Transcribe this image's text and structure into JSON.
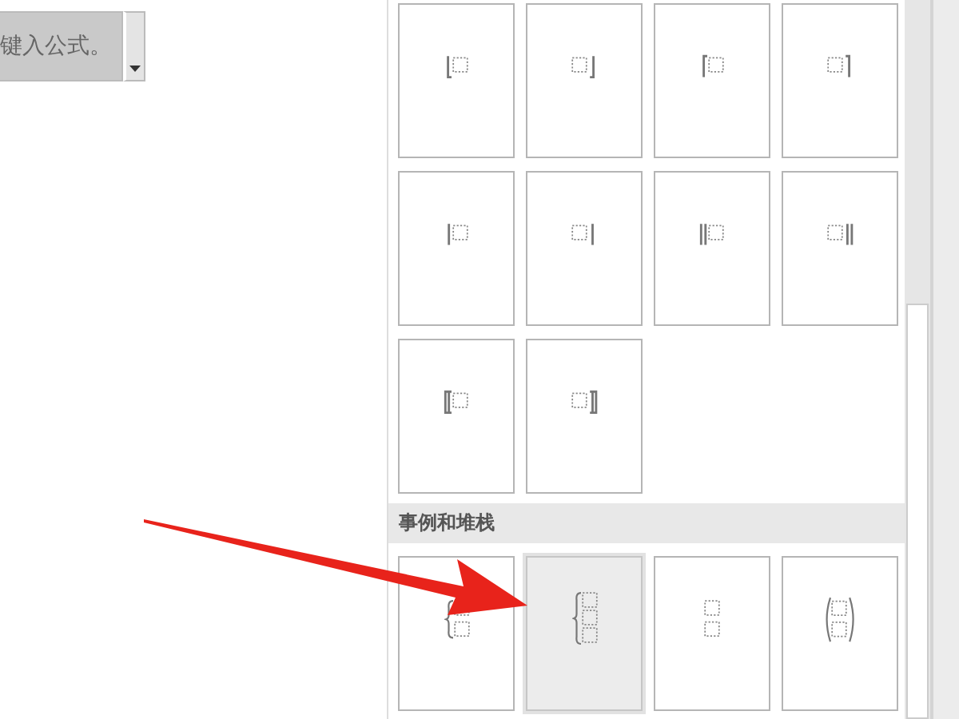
{
  "equation_field": {
    "text": "键入公式。"
  },
  "gallery": {
    "tiles": [
      {
        "kind": "floor-left",
        "selected": false
      },
      {
        "kind": "floor-right",
        "selected": false
      },
      {
        "kind": "ceil-left",
        "selected": false
      },
      {
        "kind": "ceil-right",
        "selected": false
      },
      {
        "kind": "bar-left",
        "selected": false
      },
      {
        "kind": "bar-right",
        "selected": false
      },
      {
        "kind": "dbar-left",
        "selected": false
      },
      {
        "kind": "dbar-right",
        "selected": false
      },
      {
        "kind": "dbracket-left",
        "selected": false
      },
      {
        "kind": "dbracket-right",
        "selected": false
      }
    ],
    "section": {
      "title": "事例和堆栈",
      "tiles": [
        {
          "kind": "cases2",
          "selected": false
        },
        {
          "kind": "cases3",
          "selected": true
        },
        {
          "kind": "stack2",
          "selected": false
        },
        {
          "kind": "binom",
          "selected": false
        }
      ]
    }
  }
}
